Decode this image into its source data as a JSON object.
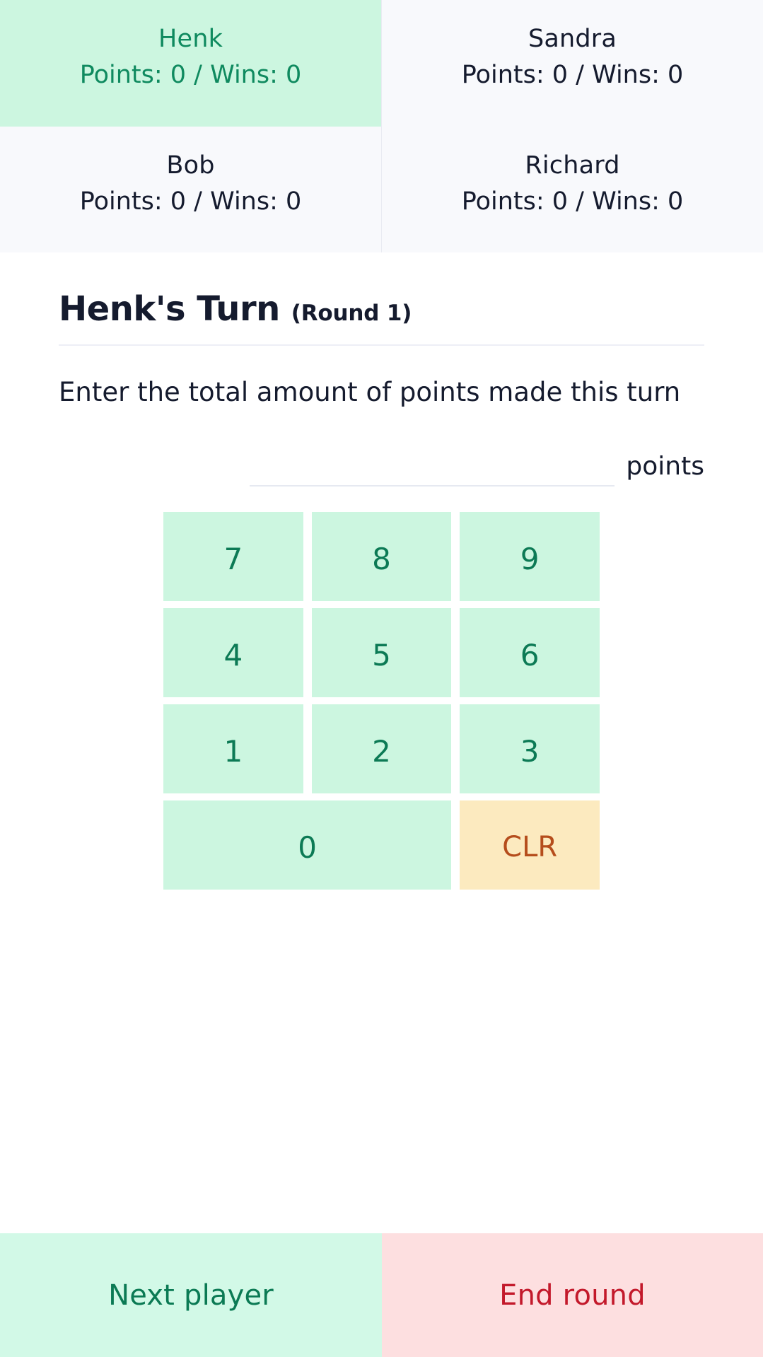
{
  "scoreboard": {
    "players": [
      {
        "name": "Henk",
        "stats": "Points: 0 / Wins: 0",
        "points": 0,
        "wins": 0,
        "active": true
      },
      {
        "name": "Sandra",
        "stats": "Points: 0 / Wins: 0",
        "points": 0,
        "wins": 0,
        "active": false
      },
      {
        "name": "Bob",
        "stats": "Points: 0 / Wins: 0",
        "points": 0,
        "wins": 0,
        "active": false
      },
      {
        "name": "Richard",
        "stats": "Points: 0 / Wins: 0",
        "points": 0,
        "wins": 0,
        "active": false
      }
    ]
  },
  "turn": {
    "title": "Henk's Turn",
    "round_label": "(Round 1)",
    "round_number": 1,
    "instruction": "Enter the total amount of points made this turn"
  },
  "input": {
    "value": "",
    "placeholder": "",
    "unit_label": "points"
  },
  "keypad": {
    "keys": [
      {
        "label": "7",
        "kind": "digit"
      },
      {
        "label": "8",
        "kind": "digit"
      },
      {
        "label": "9",
        "kind": "digit"
      },
      {
        "label": "4",
        "kind": "digit"
      },
      {
        "label": "5",
        "kind": "digit"
      },
      {
        "label": "6",
        "kind": "digit"
      },
      {
        "label": "1",
        "kind": "digit"
      },
      {
        "label": "2",
        "kind": "digit"
      },
      {
        "label": "3",
        "kind": "digit"
      },
      {
        "label": "0",
        "kind": "digit-wide"
      },
      {
        "label": "CLR",
        "kind": "clear"
      }
    ]
  },
  "footer": {
    "next_label": "Next player",
    "end_label": "End round"
  },
  "colors": {
    "active_card_bg": "#ccf6e0",
    "active_card_text": "#0f8a5f",
    "card_bg": "#f8f9fc",
    "card_text": "#151b2e",
    "key_bg": "#ccf6e0",
    "key_text": "#0c7a55",
    "clear_bg": "#fceabf",
    "clear_text": "#b54d1c",
    "next_bg": "#d2f9e7",
    "next_text": "#0b7a54",
    "end_bg": "#fddfe0",
    "end_text": "#c3192b"
  }
}
